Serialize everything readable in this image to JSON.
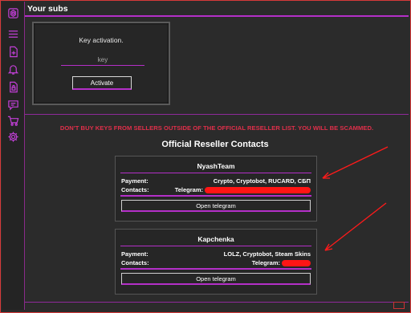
{
  "topbar": {
    "title": "Your subs"
  },
  "sidebar": {
    "icons": [
      "logo-icon",
      "menu-icon",
      "add-file-icon",
      "bell-icon",
      "file-lock-icon",
      "chat-icon",
      "cart-icon",
      "gear-icon"
    ]
  },
  "activation": {
    "title": "Key activation.",
    "placeholder": "key",
    "button_label": "Activate"
  },
  "warning": "DON'T BUY KEYS FROM SELLERS OUTSIDE OF THE OFFICIAL RESELLER LIST. YOU WILL BE SCAMMED.",
  "resellers_title": "Official Reseller Contacts",
  "resellers": [
    {
      "name": "NyashTeam",
      "payment_label": "Payment:",
      "payment": "Crypto, Cryptobot, RUCARD, СБП",
      "contacts_label": "Contacts:",
      "contacts": "Telegram:",
      "button_label": "Open telegram"
    },
    {
      "name": "Kapchenka",
      "payment_label": "Payment:",
      "payment": "LOLZ, Cryptobot, Steam Skins",
      "contacts_label": "Contacts:",
      "contacts": "Telegram:",
      "button_label": "Open telegram"
    }
  ],
  "colors": {
    "accent": "#b42fc8",
    "warning": "#e02f4a",
    "annotation": "#ff1515"
  }
}
